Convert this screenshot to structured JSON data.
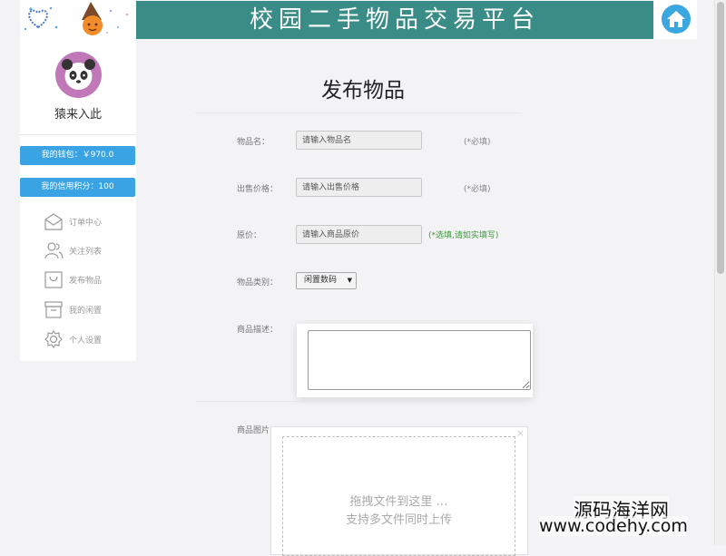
{
  "header": {
    "title": "校园二手物品交易平台",
    "home_icon": "home-icon"
  },
  "sidebar": {
    "username": "猿来入此",
    "wallet": "我的钱包：￥970.0",
    "credit": "我的信用积分：100",
    "menu": [
      {
        "label": "订单中心",
        "icon": "mail-icon"
      },
      {
        "label": "关注列表",
        "icon": "users-icon"
      },
      {
        "label": "发布物品",
        "icon": "bag-icon"
      },
      {
        "label": "我的闲置",
        "icon": "archive-icon"
      },
      {
        "label": "个人设置",
        "icon": "gear-icon"
      }
    ]
  },
  "form": {
    "title": "发布物品",
    "name_label": "物品名：",
    "name_placeholder": "请输入物品名",
    "price_label": "出售价格：",
    "price_placeholder": "请输入出售价格",
    "orig_label": "原价：",
    "orig_placeholder": "请输入商品原价",
    "required_hint": "(*必填)",
    "optional_hint": "(*选填,请如实填写)",
    "category_label": "物品类别：",
    "category_value": "闲置数码",
    "desc_label": "商品描述：",
    "image_label": "商品图片：",
    "upload_line1": "拖拽文件到这里 …",
    "upload_line2": "支持多文件同时上传",
    "upload_close": "×"
  },
  "watermark": {
    "line1": "源码海洋网",
    "line2": "www.codehy.com"
  },
  "colors": {
    "banner": "#3a8c86",
    "accent": "#3aa3e3",
    "optional_text": "#3a9b3a"
  }
}
